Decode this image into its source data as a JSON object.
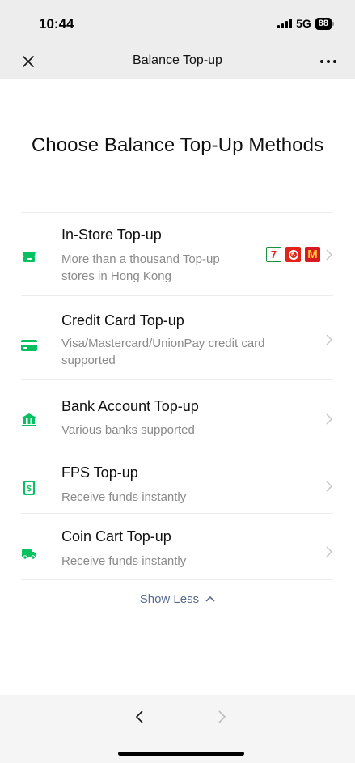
{
  "status_bar": {
    "time": "10:44",
    "network": "5G",
    "battery": "88"
  },
  "nav": {
    "title": "Balance Top-up"
  },
  "heading": "Choose Balance Top-Up Methods",
  "methods": [
    {
      "title": "In-Store Top-up",
      "description": "More than a thousand Top-up stores in Hong Kong",
      "icon": "store-icon",
      "logos": [
        "7-eleven-logo",
        "circle-k-logo",
        "mcdonalds-logo"
      ]
    },
    {
      "title": "Credit Card Top-up",
      "description": "Visa/Mastercard/UnionPay credit card supported",
      "icon": "credit-card-icon"
    },
    {
      "title": "Bank Account Top-up",
      "description": "Various banks supported",
      "icon": "bank-icon"
    },
    {
      "title": "FPS Top-up",
      "description": "Receive funds instantly",
      "icon": "fps-icon"
    },
    {
      "title": "Coin Cart Top-up",
      "description": "Receive funds instantly",
      "icon": "truck-icon"
    }
  ],
  "show_less_label": "Show Less",
  "colors": {
    "accent_green": "#07c160",
    "link_blue": "#576b95",
    "bar_gray": "#ededed"
  }
}
